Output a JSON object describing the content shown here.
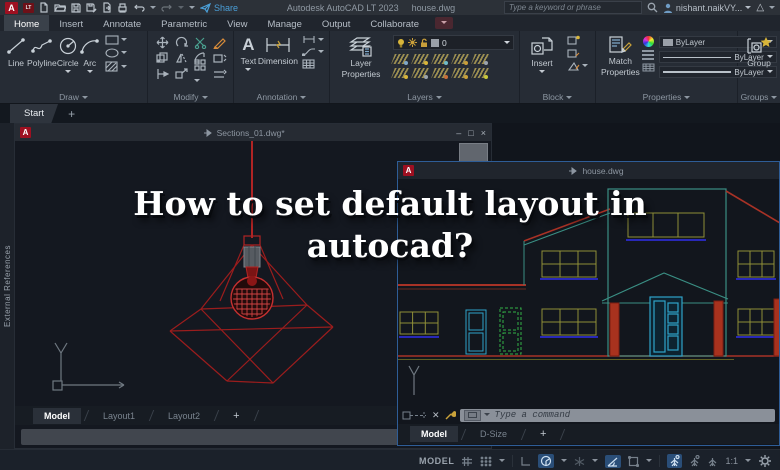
{
  "titlebar": {
    "app_title": "Autodesk AutoCAD LT 2023",
    "doc_name": "house.dwg",
    "share_label": "Share",
    "search_placeholder": "Type a keyword or phrase",
    "user_name": "nishant.naikVY...",
    "logo_a": "A",
    "logo_lt": "LT"
  },
  "ribbon_tabs": [
    {
      "label": "Home"
    },
    {
      "label": "Insert"
    },
    {
      "label": "Annotate"
    },
    {
      "label": "Parametric"
    },
    {
      "label": "View"
    },
    {
      "label": "Manage"
    },
    {
      "label": "Output"
    },
    {
      "label": "Collaborate"
    }
  ],
  "ribbon": {
    "draw": {
      "label": "Draw",
      "line": "Line",
      "polyline": "Polyline",
      "circle": "Circle",
      "arc": "Arc"
    },
    "modify": {
      "label": "Modify"
    },
    "annotation": {
      "label": "Annotation",
      "text": "Text",
      "text_icon": "A",
      "dimension": "Dimension"
    },
    "layers": {
      "label": "Layers",
      "layer_properties_1": "Layer",
      "layer_properties_2": "Properties",
      "current_layer": "0"
    },
    "block": {
      "label": "Block",
      "insert": "Insert"
    },
    "properties": {
      "label": "Properties",
      "match_1": "Match",
      "match_2": "Properties",
      "color": "ByLayer",
      "linetype": "ByLayer",
      "lineweight": "ByLayer"
    },
    "groups": {
      "label": "Groups",
      "group": "Group"
    }
  },
  "file_tabs": {
    "start": "Start",
    "add": "+"
  },
  "xref_palette": {
    "label": "External References"
  },
  "sections_window": {
    "title": "Sections_01.dwg*",
    "min": "–",
    "max": "□",
    "close": "×",
    "tab_model": "Model",
    "tab_layout1": "Layout1",
    "tab_layout2": "Layout2",
    "add_tab": "+"
  },
  "house_window": {
    "title": "house.dwg",
    "command_placeholder": "Type a command",
    "tab_model": "Model",
    "tab_dsize": "D-Size",
    "add_tab": "+"
  },
  "overlay": {
    "line1": "How to set default layout in",
    "line2": "autocad?"
  },
  "statusbar": {
    "model": "MODEL",
    "scale": "1:1"
  },
  "colors": {
    "accent_red": "#9e1021",
    "drawing_red": "#b02424",
    "teal": "#3a8f84",
    "olive": "#8f8f38",
    "cyan": "#2fa3c9",
    "green": "#33b346",
    "blue_sill": "#2828b8",
    "highlight_blue": "#2a4e78",
    "active_window_border": "#2e5d97"
  }
}
